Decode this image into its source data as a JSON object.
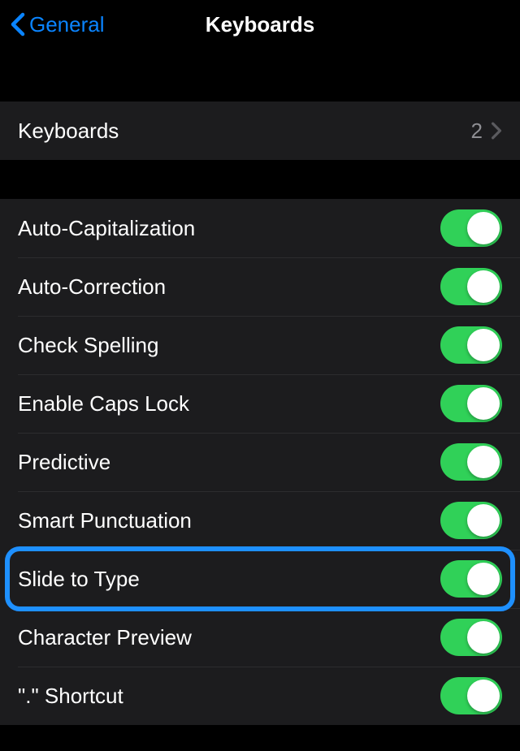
{
  "header": {
    "back_label": "General",
    "title": "Keyboards"
  },
  "keyboards_row": {
    "label": "Keyboards",
    "count": "2"
  },
  "toggles": [
    {
      "label": "Auto-Capitalization",
      "on": true,
      "highlight": false
    },
    {
      "label": "Auto-Correction",
      "on": true,
      "highlight": false
    },
    {
      "label": "Check Spelling",
      "on": true,
      "highlight": false
    },
    {
      "label": "Enable Caps Lock",
      "on": true,
      "highlight": false
    },
    {
      "label": "Predictive",
      "on": true,
      "highlight": false
    },
    {
      "label": "Smart Punctuation",
      "on": true,
      "highlight": false
    },
    {
      "label": "Slide to Type",
      "on": true,
      "highlight": true
    },
    {
      "label": "Character Preview",
      "on": true,
      "highlight": false
    },
    {
      "label": "\".\" Shortcut",
      "on": true,
      "highlight": false
    }
  ]
}
